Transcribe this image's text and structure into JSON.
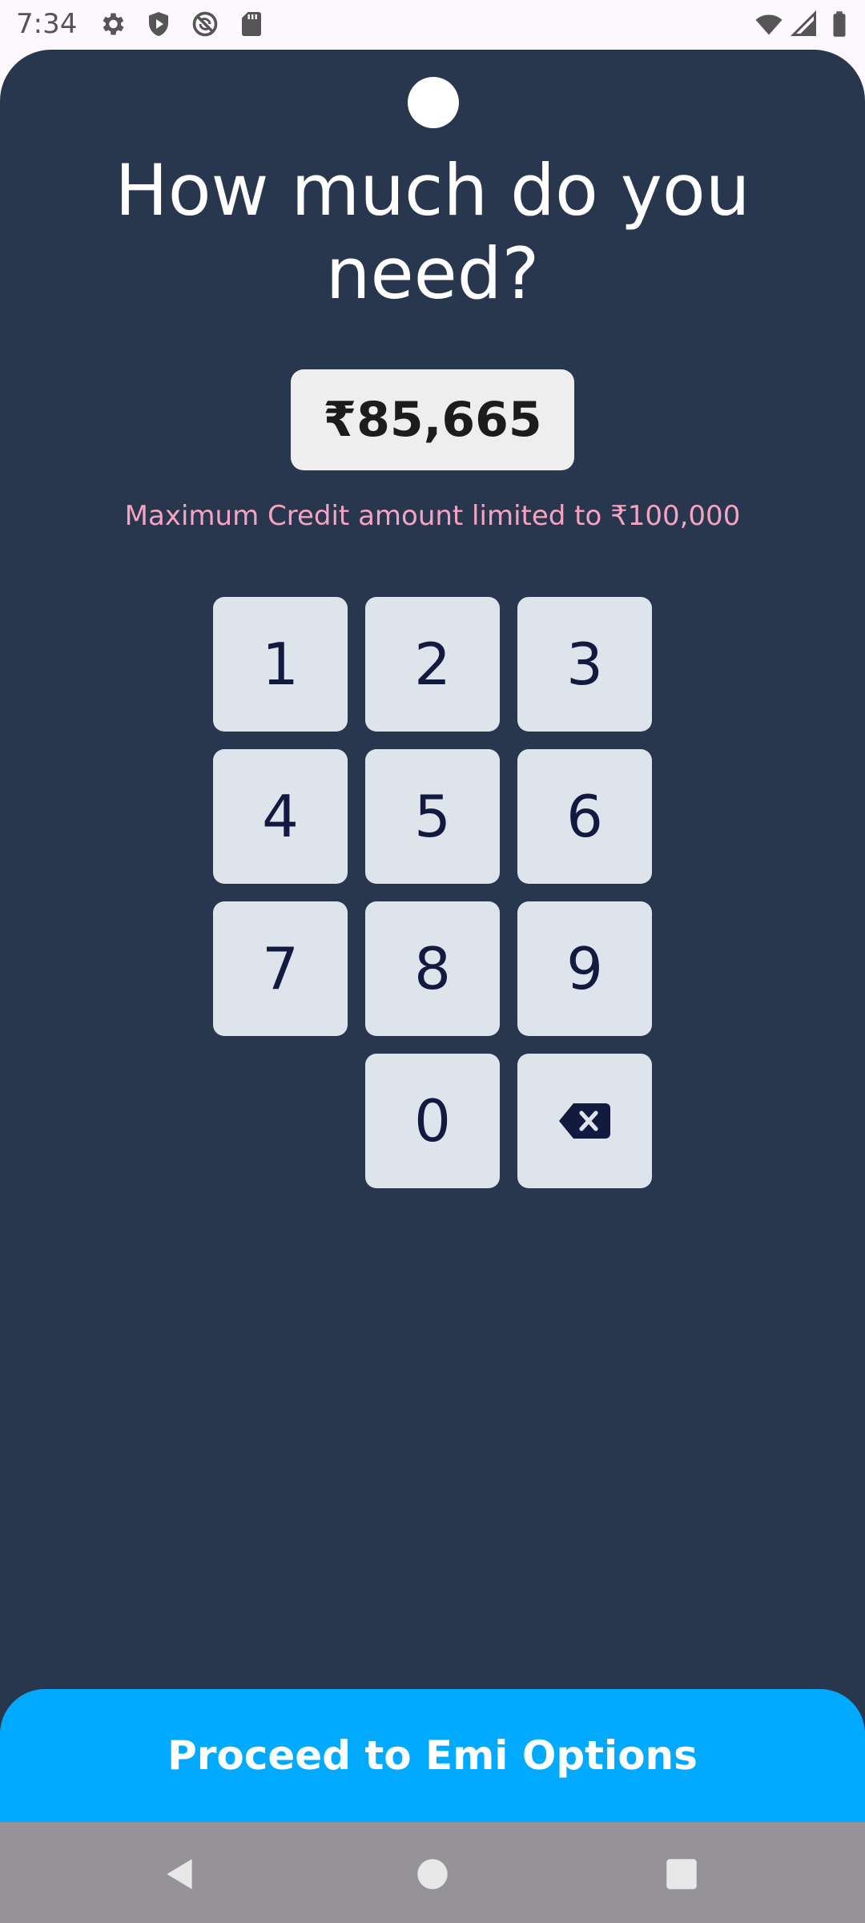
{
  "status_bar": {
    "time": "7:34",
    "icons_left": [
      "gear-icon",
      "shield-play-icon",
      "no-sync-icon",
      "sd-card-icon"
    ],
    "icons_right": [
      "wifi-icon",
      "signal-icon",
      "battery-icon"
    ]
  },
  "screen": {
    "title": "How much do you need?",
    "amount": "₹85,665",
    "limit_note": "Maximum Credit amount limited to ₹100,000"
  },
  "keypad": {
    "keys": [
      "1",
      "2",
      "3",
      "4",
      "5",
      "6",
      "7",
      "8",
      "9",
      "0"
    ],
    "backspace_icon": "backspace-icon"
  },
  "footer": {
    "proceed_label": "Proceed to Emi Options"
  },
  "nav_bar": {
    "buttons": [
      "back-icon",
      "home-icon",
      "recents-icon"
    ]
  },
  "colors": {
    "panel_bg": "#28374e",
    "amount_box_bg": "#eeeeee",
    "limit_note": "#f5a3c3",
    "key_bg": "#dde4ec",
    "key_text": "#131a40",
    "proceed_bg": "#01aaff",
    "nav_bar_bg": "#969398"
  }
}
